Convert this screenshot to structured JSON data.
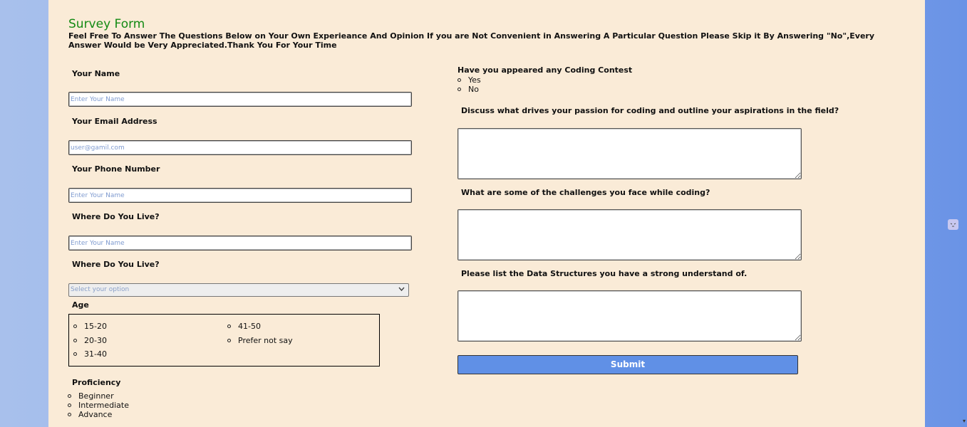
{
  "form": {
    "title": "Survey Form",
    "subtitle": "Feel Free To Answer The Questions Below on Your Own Experieance And Opinion If you are Not Convenient in Answering A Particular Question Please Skip it By Answering \"No\",Every Answer Would be Very Appreciated.Thank You For Your Time"
  },
  "left": {
    "name_label": "Your Name",
    "name_placeholder": "Enter Your Name",
    "email_label": "Your Email Address",
    "email_placeholder": "user@gamil.com",
    "phone_label": "Your Phone Number",
    "phone_placeholder": "Enter Your Name",
    "live_label": "Where Do You Live?",
    "live_placeholder": "Enter Your Name",
    "live2_label": "Where Do You Live?",
    "select_value": "Select your option",
    "age_label": "Age",
    "age_options": [
      "15-20",
      "20-30",
      "31-40",
      "41-50",
      "Prefer not say"
    ],
    "proficiency_label": "Proficiency",
    "proficiency_options": [
      "Beginner",
      "Intermediate",
      "Advance"
    ]
  },
  "right": {
    "contest_label": "Have you appeared any Coding Contest",
    "contest_options": [
      "Yes",
      "No"
    ],
    "q1_label": "Discuss what drives your passion for coding and outline your aspirations in the field?",
    "q2_label": "What are some of the challenges you face while coding?",
    "q3_label": "Please list the Data Structures you have a strong understand of.",
    "submit_label": "Submit"
  },
  "colors": {
    "card_bg": "#faebd7",
    "title": "#138a13",
    "submit_bg": "#6090e6"
  }
}
